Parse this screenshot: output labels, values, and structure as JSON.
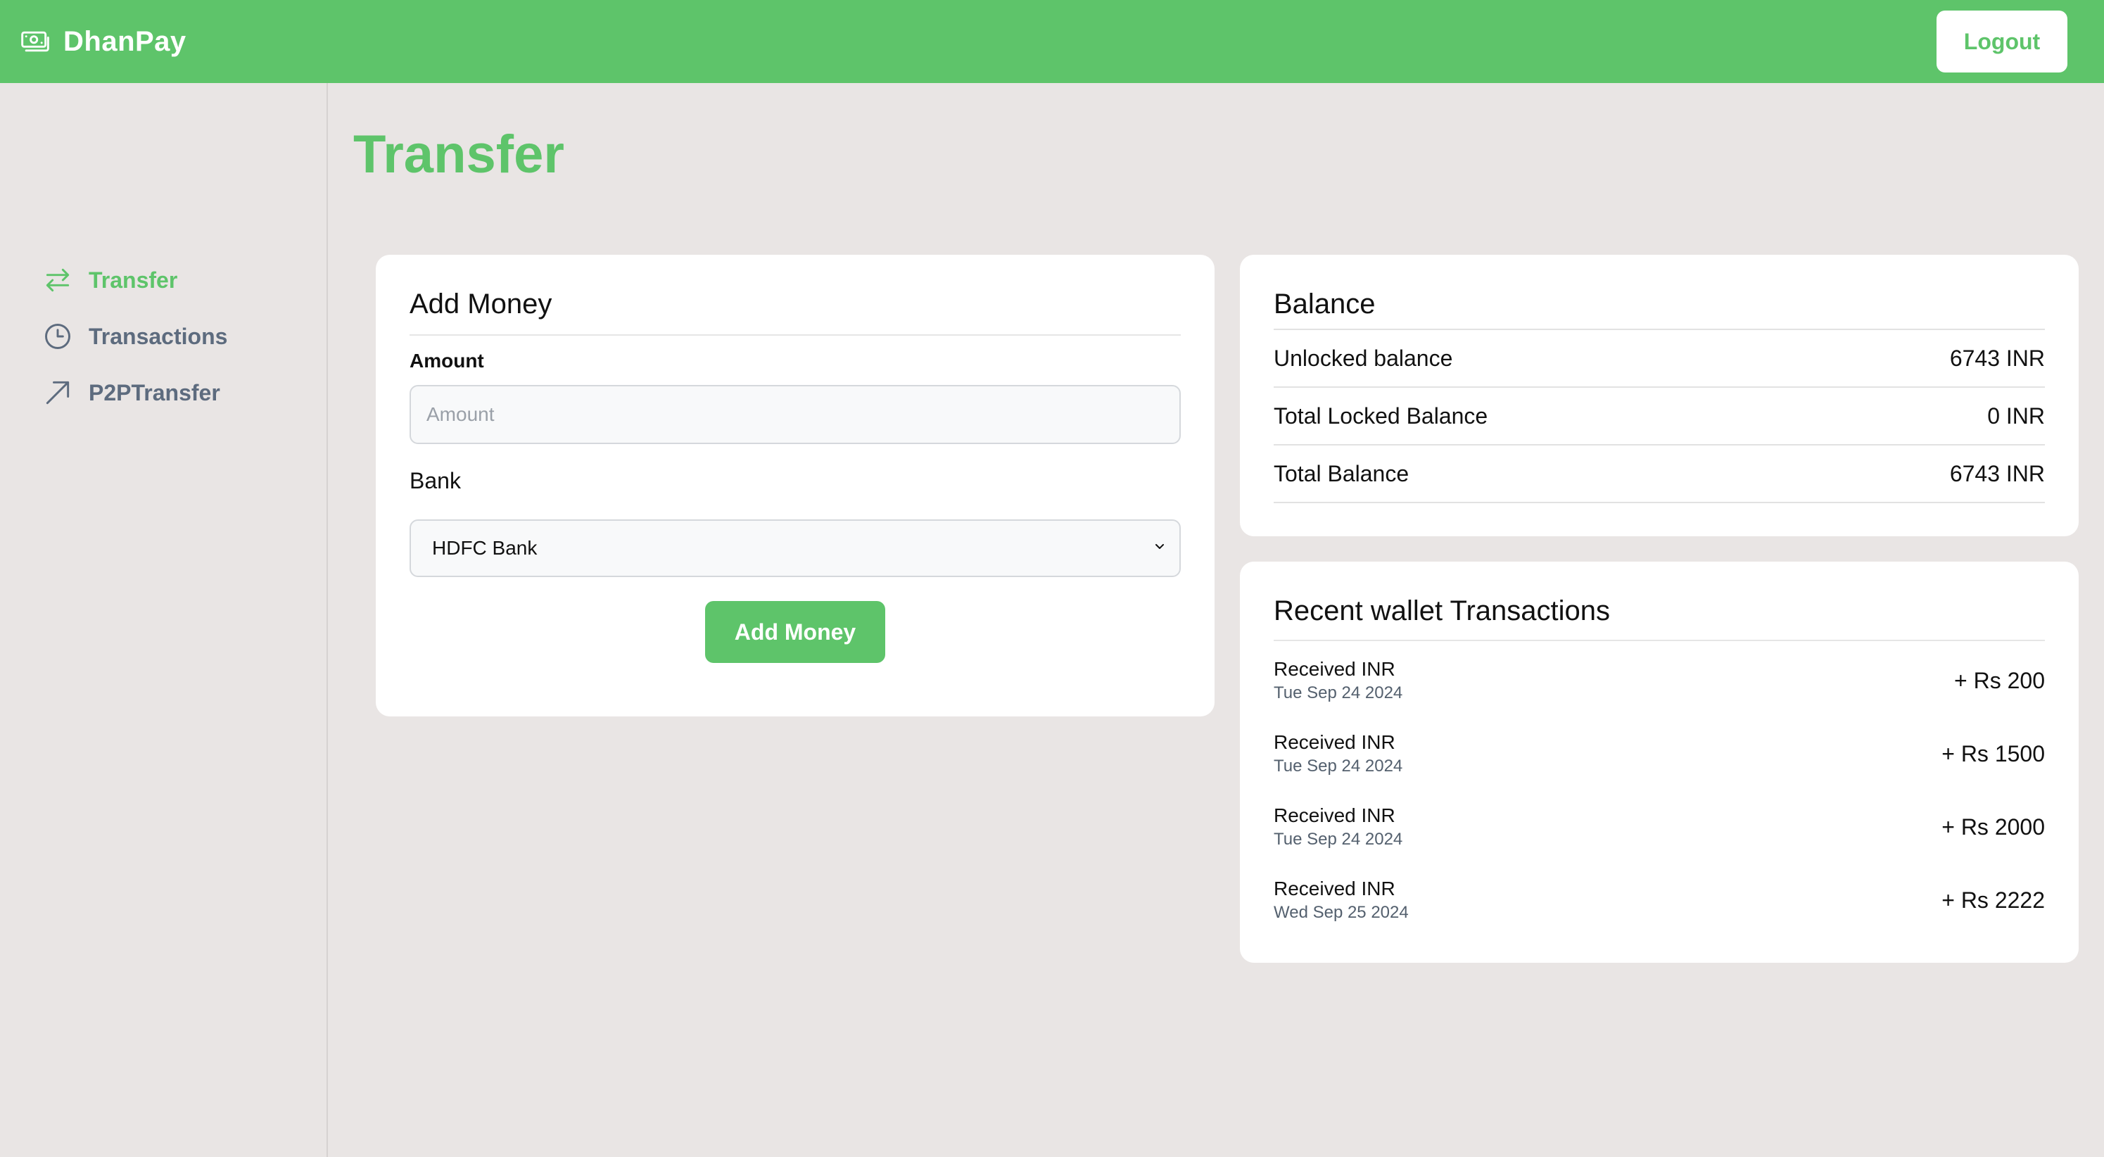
{
  "header": {
    "brand": "DhanPay",
    "brand_icon": "banknote-icon",
    "logout_label": "Logout",
    "colors": {
      "accent": "#5ec46a",
      "background": "#e9e5e4"
    }
  },
  "sidebar": {
    "items": [
      {
        "label": "Transfer",
        "icon": "transfer-arrows-icon",
        "active": true
      },
      {
        "label": "Transactions",
        "icon": "clock-icon",
        "active": false
      },
      {
        "label": "P2PTransfer",
        "icon": "arrow-up-right-icon",
        "active": false
      }
    ]
  },
  "page": {
    "title": "Transfer"
  },
  "add_money": {
    "title": "Add Money",
    "amount_label": "Amount",
    "amount_placeholder": "Amount",
    "amount_value": "",
    "bank_label": "Bank",
    "bank_selected": "HDFC Bank",
    "button_label": "Add Money"
  },
  "balance": {
    "title": "Balance",
    "rows": [
      {
        "label": "Unlocked balance",
        "value": "6743 INR"
      },
      {
        "label": "Total Locked Balance",
        "value": "0 INR"
      },
      {
        "label": "Total Balance",
        "value": "6743 INR"
      }
    ]
  },
  "recent": {
    "title": "Recent wallet Transactions",
    "items": [
      {
        "title": "Received INR",
        "date": "Tue Sep 24 2024",
        "amount": "+ Rs 200"
      },
      {
        "title": "Received INR",
        "date": "Tue Sep 24 2024",
        "amount": "+ Rs 1500"
      },
      {
        "title": "Received INR",
        "date": "Tue Sep 24 2024",
        "amount": "+ Rs 2000"
      },
      {
        "title": "Received INR",
        "date": "Wed Sep 25 2024",
        "amount": "+ Rs 2222"
      }
    ]
  }
}
